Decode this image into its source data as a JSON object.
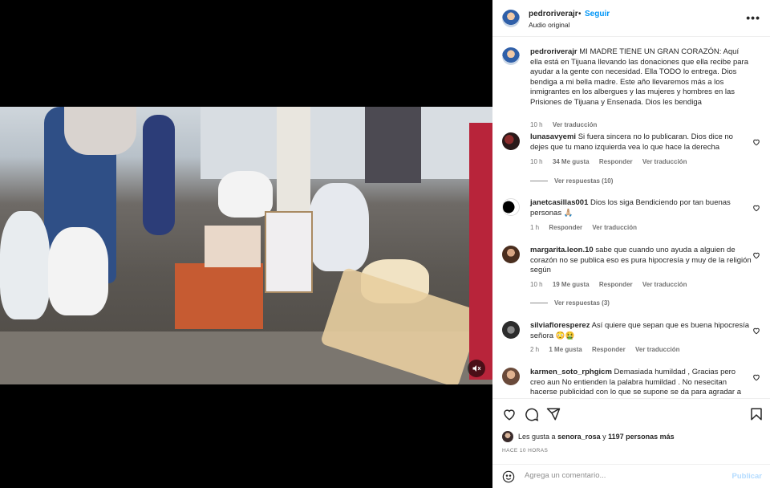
{
  "header": {
    "username": "pedroriverajr",
    "separator": "•",
    "follow_label": "Seguir",
    "audio_label": "Audio original",
    "more_label": "•••"
  },
  "caption": {
    "username": "pedroriverajr",
    "text": "MI MADRE TIENE UN GRAN CORAZÓN: Aquí ella está en Tijuana llevando las donaciones que ella recibe para ayudar a la gente con necesidad. Ella TODO lo entrega. Dios bendiga a mi bella madre. Este año llevaremos más a los inmigrantes en los albergues y las mujeres y hombres en las Prisiones de Tijuana y Ensenada. Dios les bendiga",
    "time": "10 h",
    "translate": "Ver traducción"
  },
  "comments": [
    {
      "username": "lunasavyemi",
      "text": "Si fuera sincera no lo publicaran. Dios dice no dejes que tu mano izquierda vea lo que hace la derecha",
      "time": "10 h",
      "likes": "34 Me gusta",
      "reply": "Responder",
      "translate": "Ver traducción",
      "replies": "Ver respuestas (10)"
    },
    {
      "username": "janetcasillas001",
      "text": "Dios los siga Bendiciendo por tan buenas personas 🙏🏼",
      "time": "1 h",
      "likes": "",
      "reply": "Responder",
      "translate": "Ver traducción",
      "replies": ""
    },
    {
      "username": "margarita.leon.10",
      "text": "sabe que cuando uno ayuda a alguien de corazón no se publica eso es pura hipocresía y muy de la religión según",
      "time": "10 h",
      "likes": "19 Me gusta",
      "reply": "Responder",
      "translate": "Ver traducción",
      "replies": "Ver respuestas (3)"
    },
    {
      "username": "silviafloresperez",
      "text": "Así quiere que sepan que es buena hipocresía señora 😳🤮",
      "time": "2 h",
      "likes": "1 Me gusta",
      "reply": "Responder",
      "translate": "Ver traducción",
      "replies": ""
    },
    {
      "username": "karmen_soto_rphgicm",
      "text": "Demasiada humildad , Gracias pero creo aun No entienden la palabra humildad . No nesecitan hacerse publicidad con lo que se supone se da para agradar a",
      "time": "",
      "likes": "",
      "reply": "",
      "translate": "",
      "replies": ""
    }
  ],
  "likes_summary": {
    "prefix": "Les gusta a",
    "user": "senora_rosa",
    "and": "y",
    "others": "1197 personas más"
  },
  "posted_ago": "HACE 10 HORAS",
  "add_comment": {
    "placeholder": "Agrega un comentario...",
    "post_label": "Publicar"
  },
  "icons": [
    "heart-icon",
    "comment-icon",
    "share-icon",
    "bookmark-icon",
    "emoji-icon",
    "mute-icon",
    "more-icon"
  ],
  "colors": {
    "accent": "#0095f6",
    "muted": "#737373",
    "post_disabled": "#b3dbff"
  }
}
